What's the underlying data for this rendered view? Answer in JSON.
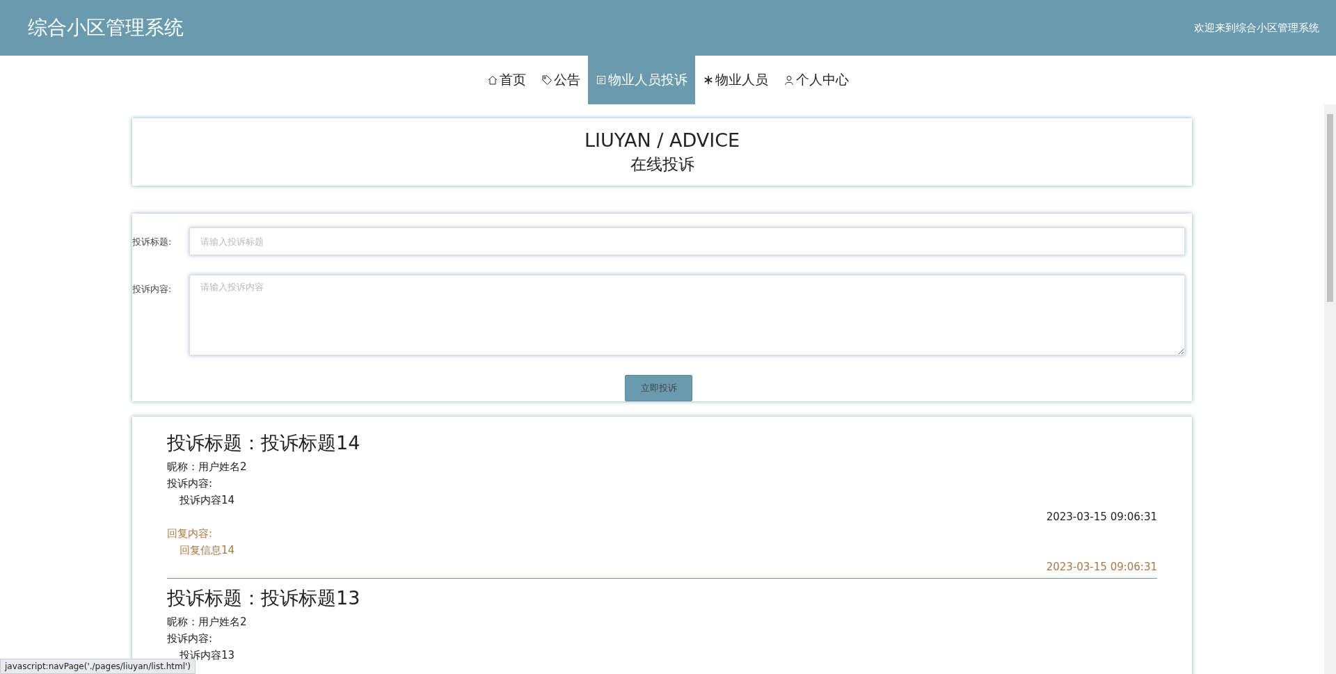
{
  "header": {
    "title": "综合小区管理系统",
    "welcome": "欢迎来到综合小区管理系统"
  },
  "nav": [
    {
      "label": "首页",
      "selected": false
    },
    {
      "label": "公告",
      "selected": false
    },
    {
      "label": "物业人员投诉",
      "selected": true
    },
    {
      "label": "物业人员",
      "selected": false
    },
    {
      "label": "个人中心",
      "selected": false
    }
  ],
  "banner": {
    "title": "LIUYAN / ADVICE",
    "subtitle": "在线投诉"
  },
  "form": {
    "title_label": "投诉标题:",
    "title_placeholder": "请输入投诉标题",
    "content_label": "投诉内容:",
    "content_placeholder": "请输入投诉内容",
    "submit": "立即投诉"
  },
  "complaints": [
    {
      "title": "投诉标题：投诉标题14",
      "nickname": "昵称：用户姓名2",
      "content_label": "投诉内容:",
      "content": "投诉内容14",
      "time": "2023-03-15 09:06:31",
      "reply_label": "回复内容:",
      "reply": "回复信息14",
      "reply_time": "2023-03-15 09:06:31"
    },
    {
      "title": "投诉标题：投诉标题13",
      "nickname": "昵称：用户姓名2",
      "content_label": "投诉内容:",
      "content": "投诉内容13"
    }
  ],
  "status_bar": "javascript:navPage('./pages/liuyan/list.html')"
}
